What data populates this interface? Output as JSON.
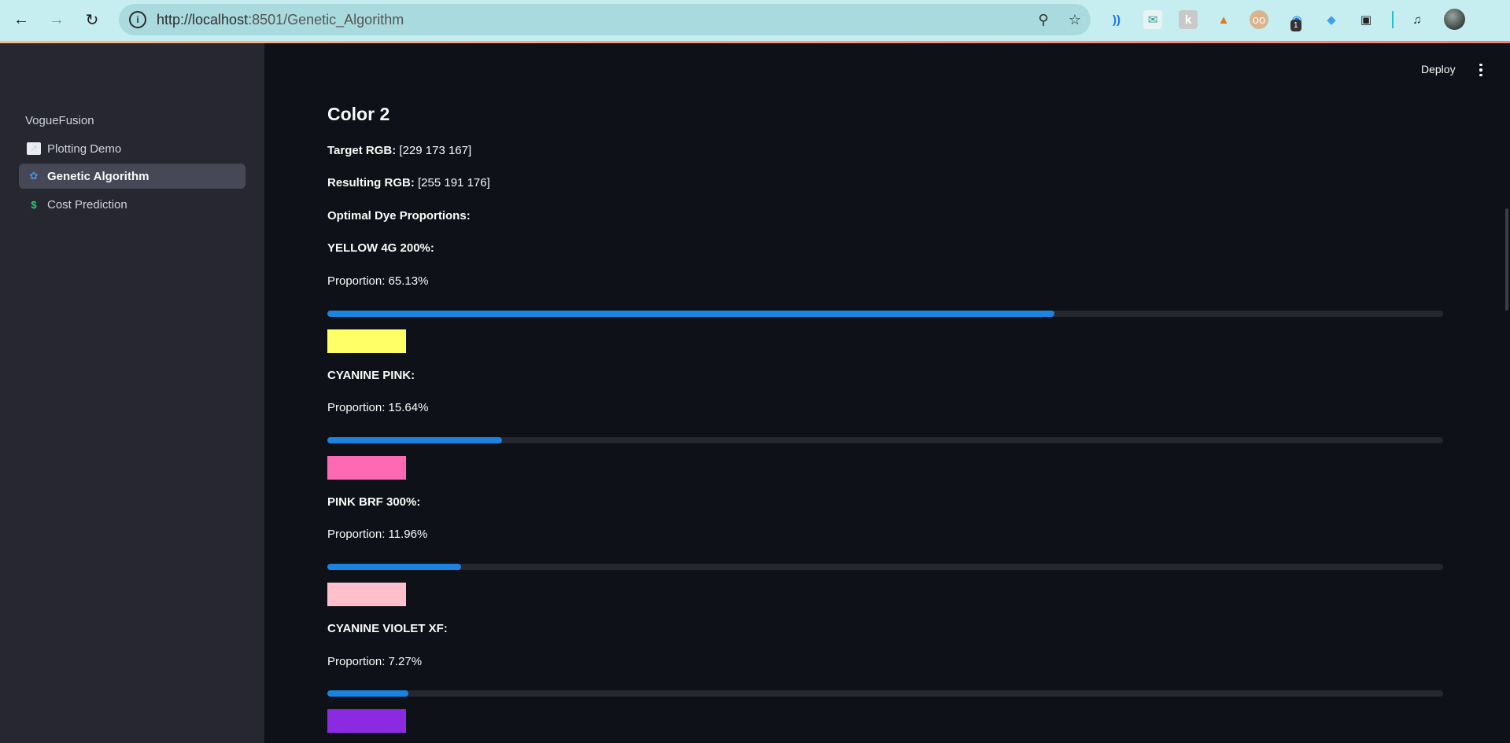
{
  "browser": {
    "url_prefix": "http://localhost",
    "url_rest": ":8501/Genetic_Algorithm",
    "extension_badge": "1"
  },
  "sidebar": {
    "app_name": "VogueFusion",
    "items": [
      {
        "label": "Plotting Demo",
        "icon": "chart-icon"
      },
      {
        "label": "Genetic Algorithm",
        "icon": "dna-icon",
        "active": true
      },
      {
        "label": "Cost Prediction",
        "icon": "dollar-icon"
      }
    ]
  },
  "header": {
    "deploy_label": "Deploy"
  },
  "main": {
    "title": "Color 2",
    "target_label": "Target RGB:",
    "target_value": "[229 173 167]",
    "result_label": "Resulting RGB:",
    "result_value": "[255 191 176]",
    "optimal_label": "Optimal Dye Proportions:",
    "dyes": [
      {
        "name": "YELLOW 4G 200%:",
        "proportion_text": "Proportion: 65.13%",
        "proportion": 0.6513,
        "color": "#ffff66"
      },
      {
        "name": "CYANINE PINK:",
        "proportion_text": "Proportion: 15.64%",
        "proportion": 0.1564,
        "color": "#ff69b4"
      },
      {
        "name": "PINK BRF 300%:",
        "proportion_text": "Proportion: 11.96%",
        "proportion": 0.1196,
        "color": "#ffc0cb"
      },
      {
        "name": "CYANINE VIOLET XF:",
        "proportion_text": "Proportion: 7.27%",
        "proportion": 0.0727,
        "color": "#8a2be2"
      }
    ]
  },
  "colors": {
    "accent": "#1c83e1",
    "sidebar_bg": "#262730",
    "main_bg": "#0e1117"
  }
}
